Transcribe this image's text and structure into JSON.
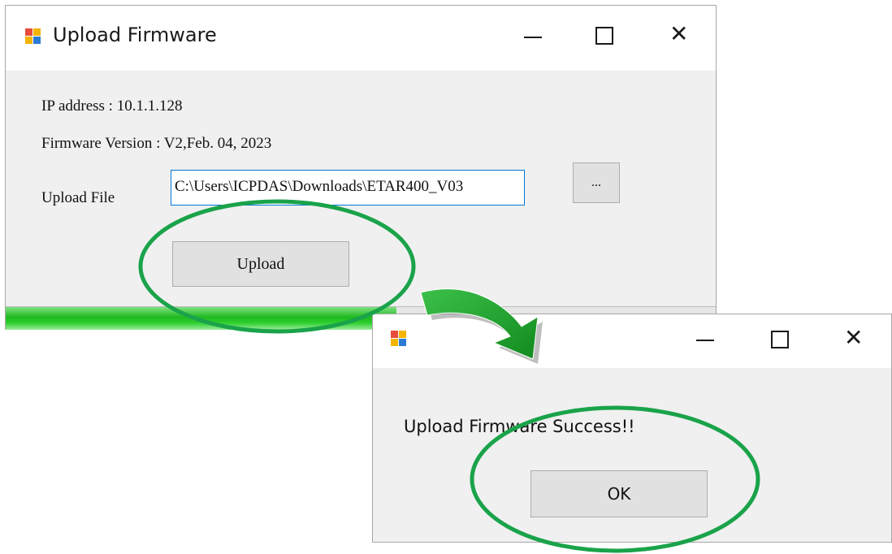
{
  "upload_window": {
    "title": "Upload Firmware",
    "icon": "app-window-icon",
    "controls": {
      "minimize": "minimize-icon",
      "maximize": "maximize-icon",
      "close": "close-icon"
    },
    "ip_label": "IP  address : 10.1.1.128",
    "firmware_label": "Firmware Version : V2,Feb. 04, 2023",
    "upload_file_label": "Upload File",
    "upload_file_value": "C:\\Users\\ICPDAS\\Downloads\\ETAR400_V03",
    "browse_label": "...",
    "upload_button": "Upload",
    "progress_fraction": 0.55,
    "progress_color": "#1fb81f"
  },
  "success_dialog": {
    "title": "",
    "icon": "app-window-icon",
    "message": "Upload Firmware Success!!",
    "ok_button": "OK"
  },
  "annotations": {
    "highlight_color": "#1aa34a",
    "arrow_color": "#1ea22e",
    "arrow_meaning": "upload leads to success dialog"
  }
}
